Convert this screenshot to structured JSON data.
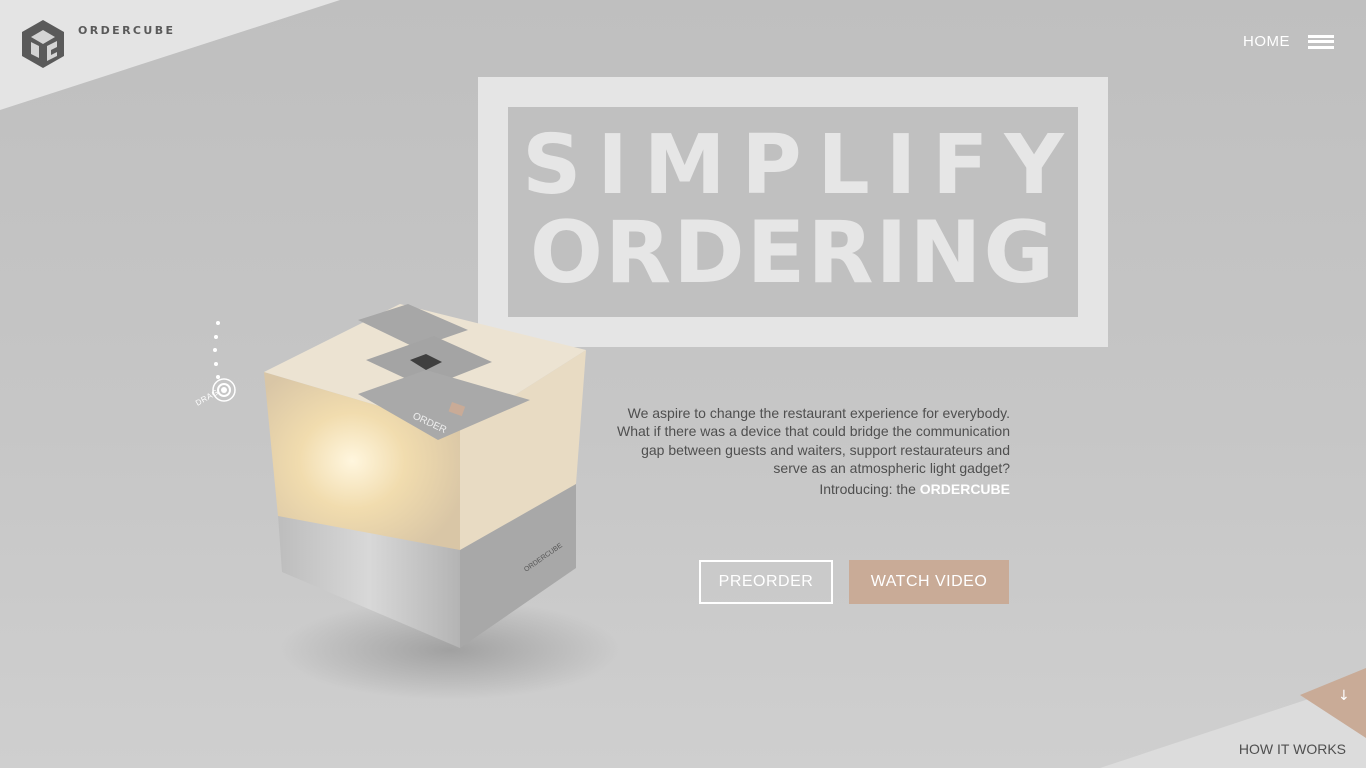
{
  "brand": {
    "name": "ORDERCUBE",
    "logo_icon": "ordercube-logo-icon"
  },
  "nav": {
    "home_label": "HOME",
    "menu_icon": "hamburger-menu-icon"
  },
  "hero": {
    "line1": "SIMPLIFY",
    "line2": "ORDERING"
  },
  "product": {
    "lid_text": "ORDER",
    "side_text": "ORDERCUBE",
    "drag_label": "DRAG"
  },
  "intro": {
    "description": "We aspire to change the restaurant experience for everybody. What if there was a device that could bridge the communication gap between guests and waiters, support restaurateurs and serve as an atmospheric light gadget?",
    "prefix": "Introducing: the",
    "product_name": "ORDERCUBE"
  },
  "buttons": {
    "preorder": "PREORDER",
    "watch_video": "WATCH VIDEO"
  },
  "footer": {
    "arrow": "↓",
    "how_it_works": "HOW IT WORKS"
  },
  "colors": {
    "accent": "#c9ab97",
    "background": "#c2c2c2",
    "panel": "#e5e5e5"
  }
}
